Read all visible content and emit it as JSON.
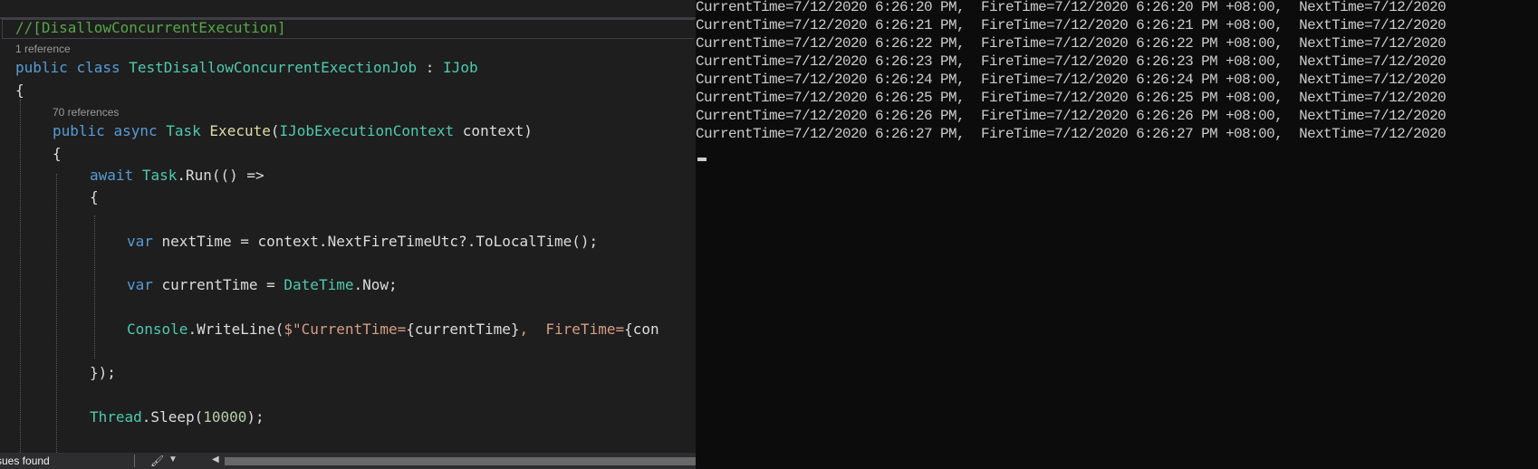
{
  "editor": {
    "attribute_comment": "//[DisallowConcurrentExecution]",
    "class_codelens": "1 reference",
    "class_decl": {
      "kw1": "public",
      "kw2": "class",
      "name": "TestDisallowConcurrentExectionJob",
      "colon": " : ",
      "iface": "IJob"
    },
    "open_brace": "{",
    "method_codelens": "70 references",
    "method_decl": {
      "kw1": "public",
      "kw2": "async",
      "ret": "Task",
      "name": "Execute",
      "params_type": "IJobExecutionContext",
      "params_name": "context",
      "open": "(",
      "close": ")"
    },
    "method_open_brace": "{",
    "await_line": {
      "kw": "await",
      "type": "Task",
      "rest": ".Run(() =>"
    },
    "lambda_open_brace": "{",
    "next_time_line": {
      "kw": "var",
      "text": " nextTime = context.NextFireTimeUtc?.ToLocalTime();"
    },
    "current_time_line": {
      "kw": "var",
      "mid": " currentTime = ",
      "type": "DateTime",
      "rest": ".Now;"
    },
    "writeline": {
      "type": "Console",
      "dot_method": ".WriteLine(",
      "str1": "$\"CurrentTime=",
      "interp1": "{currentTime}",
      "str2": ",  FireTime=",
      "interp2": "{con"
    },
    "lambda_close": "});",
    "sleep_line": {
      "type": "Thread",
      "rest": ".Sleep(",
      "num": "10000",
      "end": ");"
    }
  },
  "status_bar": {
    "issues_text": "sues found"
  },
  "console": {
    "lines": [
      "CurrentTime=7/12/2020 6:26:20 PM,  FireTime=7/12/2020 6:26:20 PM +08:00,  NextTime=7/12/2020",
      "CurrentTime=7/12/2020 6:26:21 PM,  FireTime=7/12/2020 6:26:21 PM +08:00,  NextTime=7/12/2020",
      "CurrentTime=7/12/2020 6:26:22 PM,  FireTime=7/12/2020 6:26:22 PM +08:00,  NextTime=7/12/2020",
      "CurrentTime=7/12/2020 6:26:23 PM,  FireTime=7/12/2020 6:26:23 PM +08:00,  NextTime=7/12/2020",
      "CurrentTime=7/12/2020 6:26:24 PM,  FireTime=7/12/2020 6:26:24 PM +08:00,  NextTime=7/12/2020",
      "CurrentTime=7/12/2020 6:26:25 PM,  FireTime=7/12/2020 6:26:25 PM +08:00,  NextTime=7/12/2020",
      "CurrentTime=7/12/2020 6:26:26 PM,  FireTime=7/12/2020 6:26:26 PM +08:00,  NextTime=7/12/2020",
      "CurrentTime=7/12/2020 6:26:27 PM,  FireTime=7/12/2020 6:26:27 PM +08:00,  NextTime=7/12/2020"
    ]
  },
  "colors": {
    "editor_bg": "#1e1e1e",
    "console_bg": "#0c0c0c",
    "keyword": "#569cd6",
    "type": "#4ec9b0",
    "comment": "#57a64a",
    "string": "#d69d85",
    "number": "#b5cea8"
  }
}
